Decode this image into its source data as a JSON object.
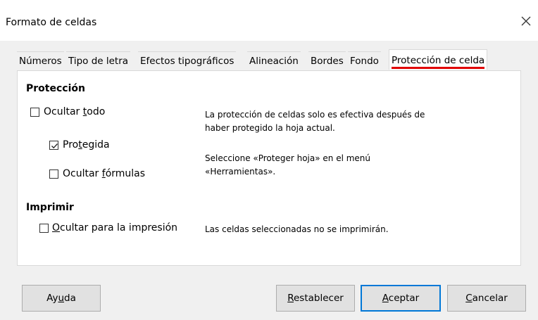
{
  "dialog": {
    "title": "Formato de celdas",
    "close_icon": "close-icon"
  },
  "tabs": [
    {
      "label": "Números",
      "active": false
    },
    {
      "label": "Tipo de letra",
      "active": false
    },
    {
      "label": "Efectos tipográficos",
      "active": false
    },
    {
      "label": "Alineación",
      "active": false
    },
    {
      "label": "Bordes",
      "active": false
    },
    {
      "label": "Fondo",
      "active": false
    },
    {
      "label": "Protección de celda",
      "active": true
    }
  ],
  "protection": {
    "title": "Protección",
    "hide_all": {
      "pre": "Ocultar ",
      "mn": "t",
      "post": "odo",
      "checked": false
    },
    "protected": {
      "pre": "Pro",
      "mn": "t",
      "post": "egida",
      "checked": true
    },
    "hide_formulas": {
      "pre": "Ocultar ",
      "mn": "f",
      "post": "órmulas",
      "checked": false
    },
    "info1_line1": "La protección de celdas solo es efectiva después de",
    "info1_line2": "haber protegido la hoja actual.",
    "info2_line1": "Seleccione «Proteger hoja» en el menú",
    "info2_line2": "«Herramientas»."
  },
  "print": {
    "title": "Imprimir",
    "hide_print": {
      "pre": "",
      "mn": "O",
      "post": "cultar para la impresión",
      "checked": false
    },
    "info": "Las celdas seleccionadas no se imprimirán."
  },
  "buttons": {
    "help": {
      "pre": "Ay",
      "mn": "u",
      "post": "da"
    },
    "reset": {
      "pre": "",
      "mn": "R",
      "post": "establecer"
    },
    "ok": {
      "pre": "",
      "mn": "A",
      "post": "ceptar"
    },
    "cancel": {
      "pre": "",
      "mn": "C",
      "post": "ancelar"
    }
  },
  "colors": {
    "accent": "#0078d7",
    "active_tab_underline": "#e00000"
  }
}
